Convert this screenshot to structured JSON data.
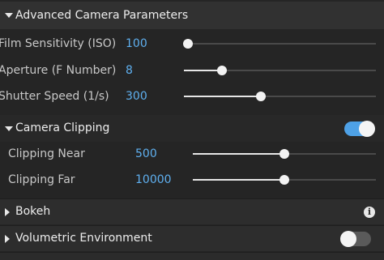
{
  "advanced_camera": {
    "title": "Advanced Camera Parameters",
    "rows": [
      {
        "label": "Film Sensitivity (ISO)",
        "value": "100",
        "level": 0.02
      },
      {
        "label": "Aperture (F Number)",
        "value": "8",
        "level": 0.2
      },
      {
        "label": "Shutter Speed (1/s)",
        "value": "300",
        "level": 0.4
      }
    ]
  },
  "camera_clipping": {
    "title": "Camera Clipping",
    "enabled": true,
    "rows": [
      {
        "label": "Clipping Near",
        "value": "500",
        "level": 0.5
      },
      {
        "label": "Clipping Far",
        "value": "10000",
        "level": 0.5
      }
    ]
  },
  "bokeh": {
    "title": "Bokeh",
    "icon": "info-icon",
    "icon_glyph": "i"
  },
  "volumetric": {
    "title": "Volumetric Environment",
    "enabled": false
  },
  "colors": {
    "accent": "#4ea1e6",
    "value_text": "#5fb0f0",
    "panel_bg": "#252525"
  }
}
